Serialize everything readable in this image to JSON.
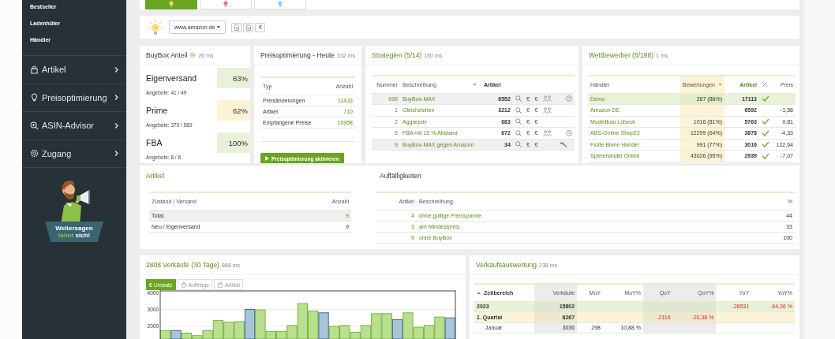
{
  "channel_tabs": [
    {
      "selected": true,
      "color": "#f5d76e"
    },
    {
      "selected": false,
      "color": "#e57373"
    },
    {
      "selected": false,
      "color": "#90caf9"
    }
  ],
  "sidebar": {
    "submenu": [
      "Bestseller",
      "Ladenhüter",
      "Händler"
    ],
    "menu": [
      {
        "kind": "bag",
        "label": "Artikel"
      },
      {
        "kind": "bulb",
        "label": "Preisoptimierung"
      },
      {
        "kind": "zoom",
        "label": "ASIN-Advisor"
      },
      {
        "kind": "gear",
        "label": "Zugang"
      }
    ],
    "slogan": {
      "line1": "Weitersagen",
      "accent": "lohnt",
      "rest": "sich!"
    }
  },
  "toolbar": {
    "marketplace": "www.amazon.de",
    "buttons": [
      {
        "kind": "doc"
      },
      {
        "kind": "doc"
      },
      {
        "kind": "text",
        "label": "€"
      }
    ]
  },
  "buybox": {
    "title": "BuyBox Anteil",
    "timing": "26 ms",
    "rows": [
      {
        "label": "Eigenversand",
        "percent": "83%",
        "color": "#e8f2d8",
        "offers": "Angebote: 41 / 49"
      },
      {
        "label": "Prime",
        "percent": "62%",
        "color": "#fcf3d6",
        "offers": "Angebote: 370 / 589"
      },
      {
        "label": "FBA",
        "percent": "100%",
        "color": "#e8f2d8",
        "offers": "Angebote: 8 / 8"
      }
    ]
  },
  "price_optimization": {
    "title": "Preisoptimierung - Heute",
    "timing": "332 ms",
    "columns": [
      "Typ",
      "Anzahl"
    ],
    "rows": [
      {
        "type": "Preisänderungen",
        "count": "11433"
      },
      {
        "type": "Artikel",
        "count": "710"
      },
      {
        "type": "Empfangene Preise",
        "count": "10958"
      }
    ],
    "button": "Preisoptimierung aktivieren"
  },
  "strategies": {
    "title": "Strategien (5/14)",
    "timing": "160 ms",
    "columns": [
      "Nummer",
      "Beschreibung",
      "Artikel"
    ],
    "rows": [
      {
        "number": "999",
        "name": "BuyBox-MAX",
        "articles": "8552",
        "euro": [
          "€",
          "€"
        ],
        "group": true,
        "clock": true,
        "hammer": false,
        "highlighted": true
      },
      {
        "number": "1",
        "name": "Gleichziehen",
        "articles": "3212",
        "euro": [
          "€",
          "€"
        ],
        "group": true,
        "clock": false,
        "hammer": false,
        "highlighted": false
      },
      {
        "number": "2",
        "name": "Aggressiv",
        "articles": "683",
        "euro": [
          "€",
          "€"
        ],
        "group": false,
        "clock": false,
        "hammer": false,
        "highlighted": false
      },
      {
        "number": "5",
        "name": "FBA mit 15 % Abstand",
        "articles": "672",
        "euro": [
          "€",
          "€"
        ],
        "group": true,
        "clock": true,
        "hammer": false,
        "highlighted": false
      },
      {
        "number": "9",
        "name": "BuyBox-MAX gegen Amazon",
        "articles": "34",
        "euro": [
          "€",
          "€"
        ],
        "group": false,
        "clock": false,
        "hammer": true,
        "highlighted": true
      }
    ]
  },
  "competitors": {
    "title": "Wettbewerber (5/198)",
    "timing": "1 ms",
    "columns": [
      "Händler",
      "Bewertungen",
      "Artikel",
      "Preis"
    ],
    "rows": [
      {
        "name": "Demo",
        "ratings": "267 (86%)",
        "articles": "17113",
        "check": true,
        "highlighted": true
      },
      {
        "name": "Amazon DE",
        "articles": "6592",
        "check": false,
        "price": "-1,58",
        "highlighted": false
      },
      {
        "name": "Modellbau Lübeck",
        "ratings": "1016 (81%)",
        "articles": "5763",
        "check": true,
        "price": "0,81",
        "highlighted": false
      },
      {
        "name": "ABS-Online Shop23",
        "ratings": "12299 (64%)",
        "articles": "3878",
        "check": true,
        "price": "-4,33",
        "highlighted": false
      },
      {
        "name": "Flotte Biene Handel",
        "ratings": "991 (77%)",
        "articles": "3016",
        "check": true,
        "price": "122,64",
        "highlighted": false
      },
      {
        "name": "Spielehandel Online",
        "ratings": "43026 (95%)",
        "articles": "2939",
        "check": true,
        "price": "-7,07",
        "highlighted": false
      }
    ]
  },
  "articles": {
    "title": "Artikel",
    "columns": [
      "Zustand / Versand",
      "Anzahl"
    ],
    "rows": [
      {
        "label": "Total:",
        "count": "9",
        "total": true
      },
      {
        "label": "Neu / Eigenversand",
        "count": "9",
        "total": false
      }
    ]
  },
  "anomalies": {
    "title": "Auffälligkeiten",
    "columns": [
      "Artikel",
      "Beschreibung",
      "%"
    ],
    "rows": [
      {
        "count": "4",
        "description": "ohne gültige Preisspanne",
        "percent": "44"
      },
      {
        "count": "3",
        "description": "am Mindestpreis",
        "percent": "33"
      },
      {
        "count": "9",
        "description": "ohne BuyBox",
        "percent": "100"
      }
    ]
  },
  "sales_chart": {
    "title": "2808 Verkäufe (30 Tage)",
    "timing": "888 ms",
    "tabs": [
      {
        "kind": "plain",
        "label": "€ Umsatz",
        "selected": true
      },
      {
        "kind": "orders",
        "label": "Aufträge",
        "selected": false
      },
      {
        "kind": "bag",
        "label": "Artikel",
        "selected": false
      }
    ],
    "chart_data": {
      "type": "bar",
      "stacked": true,
      "ylim": [
        1250,
        4050
      ],
      "yticks": [
        2000,
        3000,
        4000
      ],
      "series": [
        {
          "color": "#b9e08f",
          "values": [
            1750,
            null,
            1600,
            1450,
            1750,
            2350,
            2250,
            2280,
            null,
            2970,
            1700,
            1700,
            2050,
            3350,
            2900,
            null,
            2000,
            2050,
            1650,
            2050,
            2750,
            2750,
            null,
            2800,
            1950,
            2050,
            2550,
            null
          ]
        },
        {
          "color": "#a9c4d6",
          "values": [
            null,
            1750,
            null,
            null,
            null,
            null,
            null,
            null,
            3000,
            null,
            null,
            null,
            null,
            null,
            null,
            2800,
            null,
            null,
            null,
            null,
            null,
            null,
            2400,
            null,
            null,
            null,
            null,
            2500
          ]
        }
      ]
    }
  },
  "sales_report": {
    "title": "Verkaufsauswertung",
    "timing": "238 ms",
    "columns": [
      "Zeitbereich",
      "Verkäufe",
      "MoY",
      "MoY%",
      "QoY",
      "QoY%",
      "YoY",
      "YoY%"
    ],
    "rows": [
      {
        "kind": "year",
        "cells": [
          {
            "text": "2023"
          },
          {
            "text": "15802"
          },
          null,
          null,
          null,
          null,
          {
            "text": "-28531",
            "down": true
          },
          {
            "text": "-64,36 %",
            "down": true
          }
        ]
      },
      {
        "kind": "quarter",
        "cells": [
          {
            "text": "1. Quartal"
          },
          {
            "text": "8267"
          },
          null,
          null,
          {
            "text": "-2116",
            "down": true
          },
          {
            "text": "-20,38 %",
            "down": true
          },
          null,
          null
        ]
      },
      {
        "kind": "month",
        "cells": [
          {
            "text": "Januar"
          },
          {
            "text": "3036"
          },
          {
            "text": "298",
            "down": false
          },
          {
            "text": "10,88 %",
            "down": false
          },
          null,
          null,
          null,
          null
        ]
      }
    ]
  }
}
